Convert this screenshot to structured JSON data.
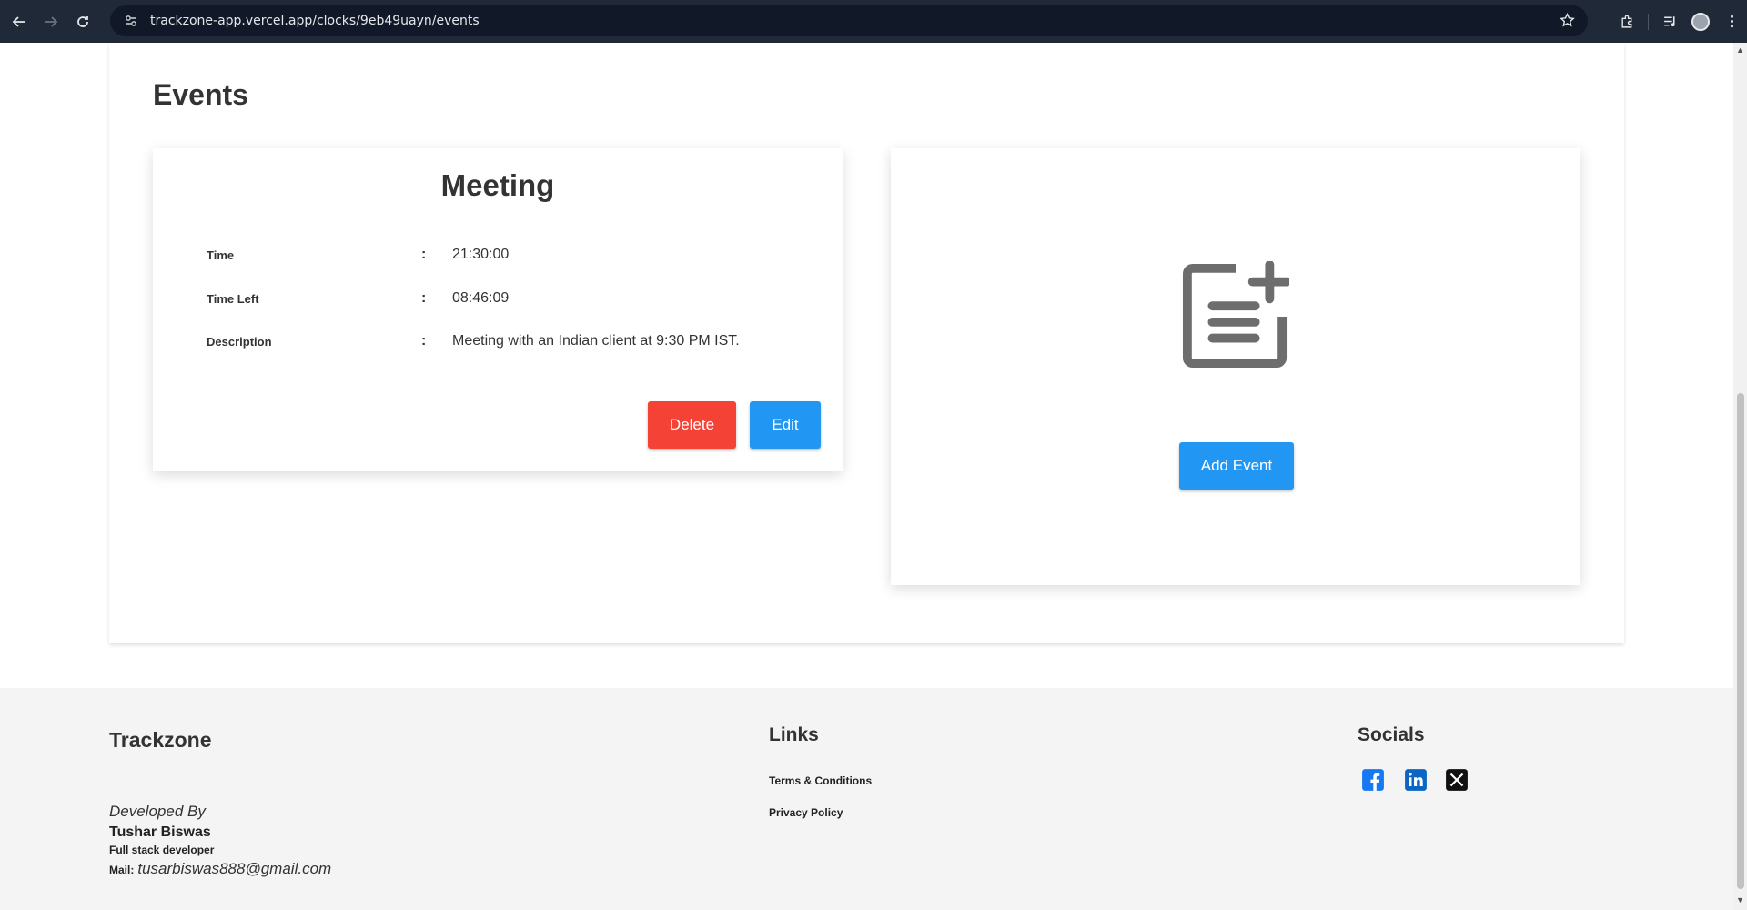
{
  "browser": {
    "url": "trackzone-app.vercel.app/clocks/9eb49uayn/events"
  },
  "events": {
    "title": "Events",
    "event": {
      "name": "Meeting",
      "time_label": "Time",
      "time_value": "21:30:00",
      "time_left_label": "Time Left",
      "time_left_value": "08:46:09",
      "description_label": "Description",
      "description_value": "Meeting with an Indian client at 9:30 PM IST.",
      "colon": ":",
      "delete_label": "Delete",
      "edit_label": "Edit"
    },
    "add_event_label": "Add Event"
  },
  "footer": {
    "brand": "Trackzone",
    "developed_by": "Developed By",
    "developer_name": "Tushar Biswas",
    "developer_role": "Full stack developer",
    "mail_label": "Mail:",
    "mail_value": "tusarbiswas888@gmail.com",
    "links_heading": "Links",
    "links": [
      "Terms & Conditions",
      "Privacy Policy"
    ],
    "socials_heading": "Socials"
  },
  "colors": {
    "delete": "#f44336",
    "primary": "#2196f3",
    "facebook": "#1877f2",
    "linkedin": "#0a66c2",
    "x": "#000000"
  }
}
